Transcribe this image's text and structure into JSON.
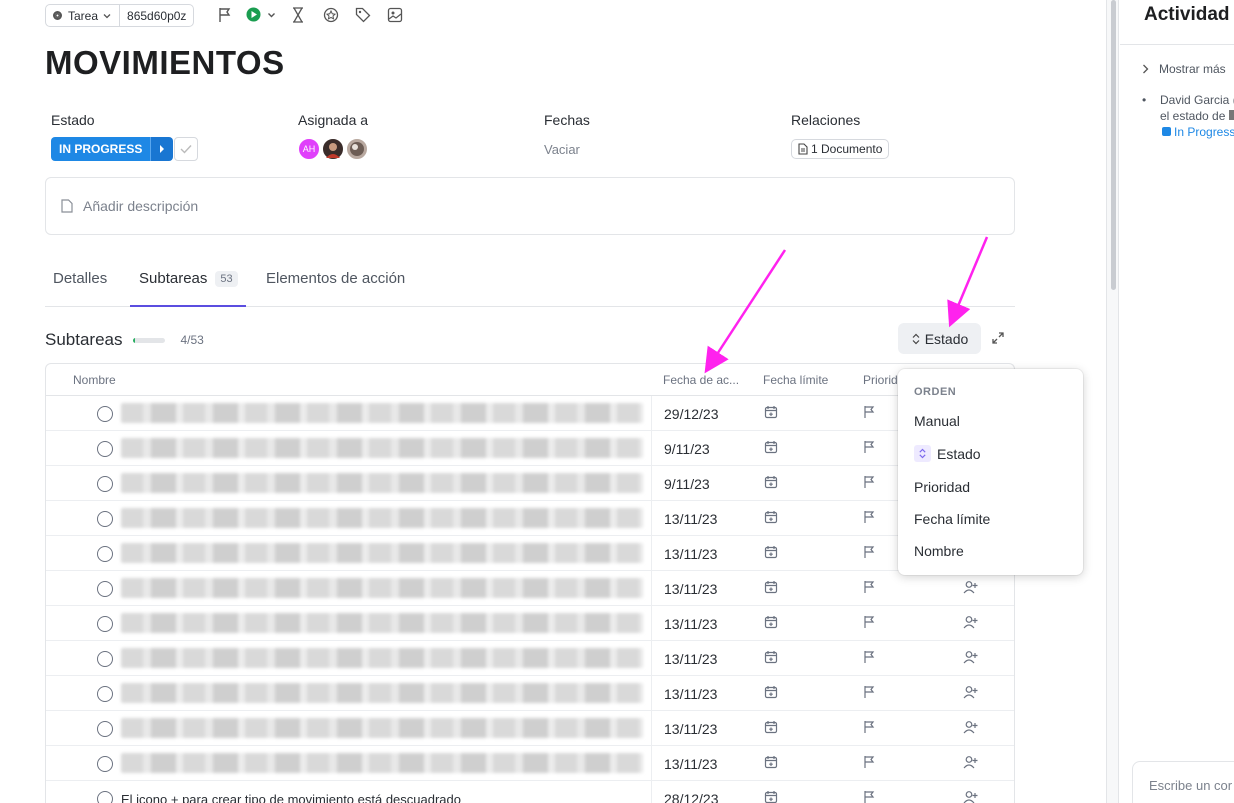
{
  "toolbar": {
    "type_label": "Tarea",
    "task_id": "865d60p0z"
  },
  "task": {
    "title": "MOVIMIENTOS"
  },
  "fields": {
    "status_label": "Estado",
    "status_value": "IN PROGRESS",
    "assigned_label": "Asignada a",
    "assignee_initials": "AH",
    "dates_label": "Fechas",
    "dates_value": "Vaciar",
    "relations_label": "Relaciones",
    "relations_value": "1 Documento"
  },
  "description": {
    "placeholder": "Añadir descripción"
  },
  "tabs": [
    {
      "label": "Detalles",
      "badge": ""
    },
    {
      "label": "Subtareas",
      "badge": "53"
    },
    {
      "label": "Elementos de acción",
      "badge": ""
    }
  ],
  "subtasks": {
    "title": "Subtareas",
    "progress_count": "4/53",
    "progress_fraction": 0.075,
    "sort_button": "Estado",
    "columns": {
      "name": "Nombre",
      "start_date": "Fecha de ac...",
      "due_date": "Fecha límite",
      "priority": "Priorid"
    },
    "rows": [
      {
        "date": "29/12/23",
        "name": ""
      },
      {
        "date": "9/11/23",
        "name": ""
      },
      {
        "date": "9/11/23",
        "name": ""
      },
      {
        "date": "13/11/23",
        "name": ""
      },
      {
        "date": "13/11/23",
        "name": ""
      },
      {
        "date": "13/11/23",
        "name": ""
      },
      {
        "date": "13/11/23",
        "name": ""
      },
      {
        "date": "13/11/23",
        "name": ""
      },
      {
        "date": "13/11/23",
        "name": ""
      },
      {
        "date": "13/11/23",
        "name": ""
      },
      {
        "date": "13/11/23",
        "name": ""
      },
      {
        "date": "28/12/23",
        "name": "El icono + para crear tipo de movimiento está descuadrado"
      }
    ]
  },
  "sort_menu": {
    "header": "ORDEN",
    "items": [
      "Manual",
      "Estado",
      "Prioridad",
      "Fecha límite",
      "Nombre"
    ],
    "selected": "Estado"
  },
  "activity": {
    "title": "Actividad",
    "show_more": "Mostrar más",
    "entry_line1": "David Garcia (",
    "entry_line2": "el estado de",
    "entry_status": "In Progress",
    "comment_placeholder": "Escribe un cor"
  },
  "colors": {
    "status_blue": "#1e88e5",
    "annotation_arrow": "#ff22ee",
    "tab_accent": "#5b4ee0"
  }
}
